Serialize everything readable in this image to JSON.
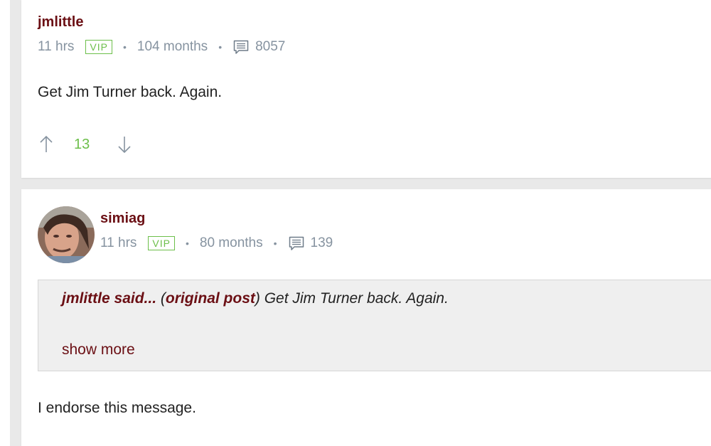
{
  "comments": [
    {
      "username": "jmlittle",
      "time": "11 hrs",
      "badge": "VIP",
      "tenure": "104 months",
      "post_count": "8057",
      "body": "Get Jim Turner back. Again.",
      "score": "13"
    },
    {
      "username": "simiag",
      "time": "11 hrs",
      "badge": "VIP",
      "tenure": "80 months",
      "post_count": "139",
      "quote": {
        "author": "jmlittle said...",
        "paren_open": " (",
        "link": "original post",
        "paren_close": ")",
        "text": " Get Jim Turner back. Again.",
        "show_more": "show more"
      },
      "body": "I endorse this message."
    }
  ],
  "colors": {
    "username": "#6b0f14",
    "meta": "#8693a0",
    "vip": "#6cbf4a",
    "score": "#6cbf4a"
  },
  "icons": {
    "comment": "comment-bubble-icon",
    "upvote": "arrow-up-icon",
    "downvote": "arrow-down-icon"
  }
}
